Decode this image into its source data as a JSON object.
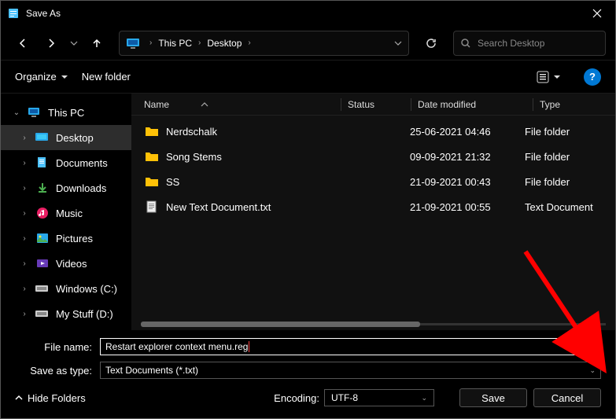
{
  "titlebar": {
    "title": "Save As"
  },
  "nav": {
    "breadcrumbs": [
      "This PC",
      "Desktop"
    ],
    "search_placeholder": "Search Desktop"
  },
  "toolbar": {
    "organize": "Organize",
    "newfolder": "New folder",
    "help": "?"
  },
  "sidebar": {
    "root": "This PC",
    "items": [
      "Desktop",
      "Documents",
      "Downloads",
      "Music",
      "Pictures",
      "Videos",
      "Windows (C:)",
      "My Stuff (D:)"
    ]
  },
  "columns": {
    "name": "Name",
    "status": "Status",
    "date": "Date modified",
    "type": "Type"
  },
  "files": [
    {
      "name": "Nerdschalk",
      "date": "25-06-2021 04:46",
      "type": "File folder",
      "kind": "folder"
    },
    {
      "name": "Song Stems",
      "date": "09-09-2021 21:32",
      "type": "File folder",
      "kind": "folder"
    },
    {
      "name": "SS",
      "date": "21-09-2021 00:43",
      "type": "File folder",
      "kind": "folder"
    },
    {
      "name": "New Text Document.txt",
      "date": "21-09-2021 00:55",
      "type": "Text Document",
      "kind": "txt"
    }
  ],
  "form": {
    "filename_label": "File name:",
    "filename_value": "Restart explorer context menu.reg",
    "type_label": "Save as type:",
    "type_value": "Text Documents (*.txt)"
  },
  "footer": {
    "hide_folders": "Hide Folders",
    "encoding_label": "Encoding:",
    "encoding_value": "UTF-8",
    "save": "Save",
    "cancel": "Cancel"
  }
}
